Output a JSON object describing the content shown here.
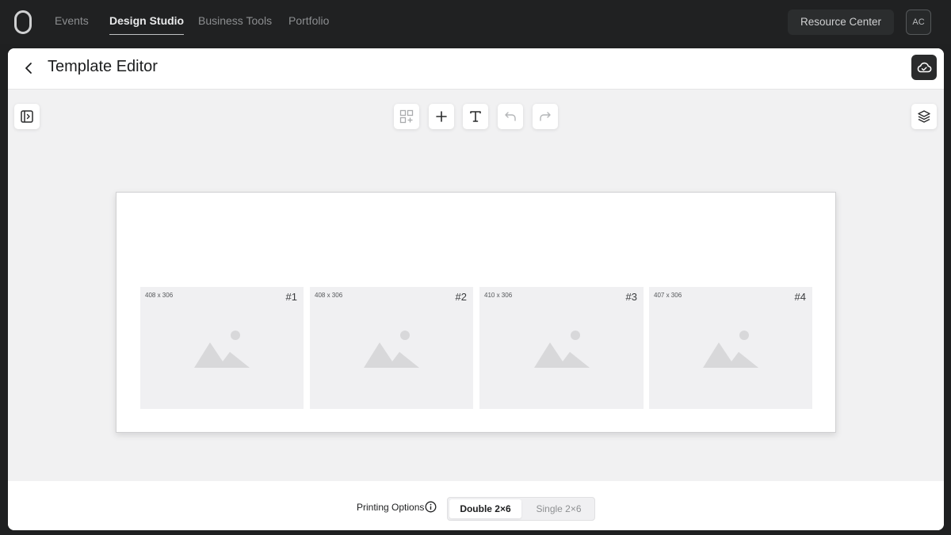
{
  "topnav": {
    "items": [
      {
        "label": "Events",
        "active": false
      },
      {
        "label": "Design Studio",
        "active": true
      },
      {
        "label": "Business Tools",
        "active": false
      },
      {
        "label": "Portfolio",
        "active": false
      }
    ],
    "resource_label": "Resource Center",
    "avatar_initials": "AC"
  },
  "editor": {
    "title": "Template Editor",
    "toolbar": [
      "add-grid-icon",
      "plus-icon",
      "text-icon",
      "undo-icon",
      "redo-icon"
    ],
    "left_tool": "sidebar-toggle-icon",
    "right_tool": "layers-icon",
    "save_tool": "cloud-icon"
  },
  "canvas": {
    "slots": [
      {
        "dims": "408 x 306",
        "num": "#1"
      },
      {
        "dims": "408 x 306",
        "num": "#2"
      },
      {
        "dims": "410 x 306",
        "num": "#3"
      },
      {
        "dims": "407 x 306",
        "num": "#4"
      }
    ]
  },
  "footer": {
    "printing_label": "Printing Options",
    "options": [
      "Double 2×6",
      "Single 2×6"
    ],
    "selected": "Double 2×6"
  },
  "colors": {
    "nav_bg": "#202122",
    "accent_dark": "#2a2b2c",
    "canvas_bg": "#f1f1f2",
    "placeholder": "#f0f0f2"
  }
}
